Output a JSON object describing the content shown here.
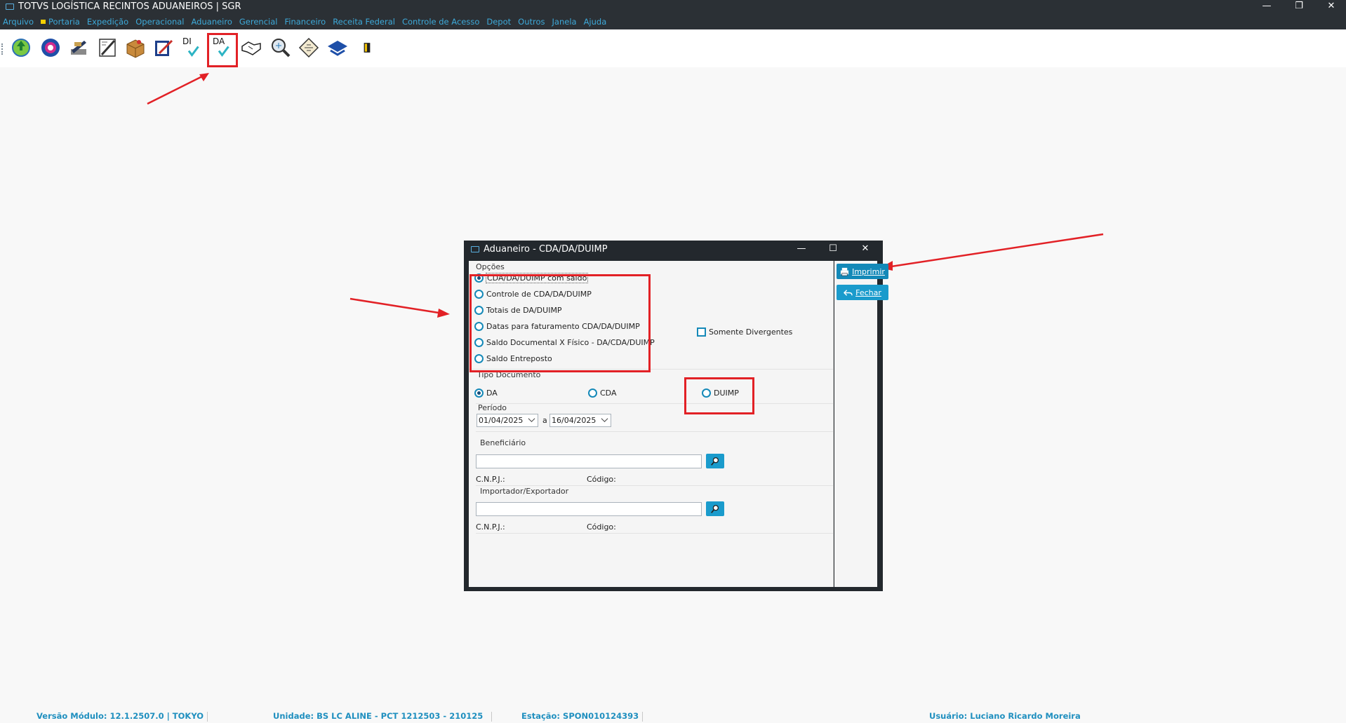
{
  "app": {
    "title": "TOTVS LOGÍSTICA RECINTOS ADUANEIROS | SGR",
    "menu": [
      "Arquivo",
      "Portaria",
      "Expedição",
      "Operacional",
      "Aduaneiro",
      "Gerencial",
      "Financeiro",
      "Receita Federal",
      "Controle de Acesso",
      "Depot",
      "Outros",
      "Janela",
      "Ajuda"
    ]
  },
  "toolbar": {
    "di_label": "DI",
    "da_label": "DA"
  },
  "dialog": {
    "title": "Aduaneiro - CDA/DA/DUIMP",
    "opcoes_label": "Opções",
    "opcoes": [
      "CDA/DA/DUIMP com saldo",
      "Controle de CDA/DA/DUIMP",
      "Totais de DA/DUIMP",
      "Datas para faturamento CDA/DA/DUIMP",
      "Saldo Documental  X  Físico - DA/CDA/DUIMP",
      "Saldo Entreposto"
    ],
    "selected_opcao": 0,
    "somente_divergentes": "Somente Divergentes",
    "tipo_documento_label": "Tipo Documento",
    "tipo_documento": [
      "DA",
      "CDA",
      "DUIMP"
    ],
    "selected_tipo": 0,
    "periodo_label": "Período",
    "periodo_inicio": "01/04/2025",
    "periodo_a": "a",
    "periodo_fim": "16/04/2025",
    "beneficiario_label": "Beneficiário",
    "cnpj_label": "C.N.P.J.:",
    "codigo_label": "Código:",
    "importador_label": "Importador/Exportador",
    "imprimir": "Imprimir",
    "fechar": "Fechar"
  },
  "status": {
    "versao": "Versão Módulo:  12.1.2507.0  |  TOKYO",
    "unidade": "Unidade: BS LC ALINE - PCT 1212503 - 210125",
    "estacao": "Estação: SPON010124393",
    "usuario": "Usuário: Luciano Ricardo Moreira"
  },
  "colors": {
    "accent": "#1a9bcc",
    "menu_link": "#3da9d9",
    "highlight": "#e22126",
    "titlebar": "#2b3035"
  }
}
